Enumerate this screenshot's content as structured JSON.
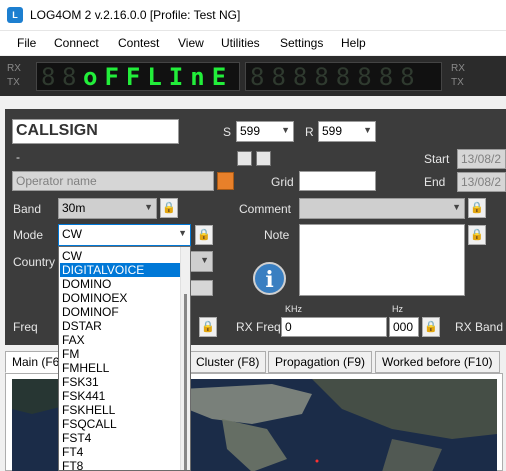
{
  "window": {
    "title": "LOG4OM 2 v.2.16.0.0 [Profile: Test NG]",
    "icon": "app-icon"
  },
  "menu": [
    "File",
    "Connect",
    "Contest",
    "View",
    "Utilities",
    "Settings",
    "Help"
  ],
  "led": {
    "rx": "RX",
    "tx": "TX",
    "display_text": "oFFLInE",
    "right_rx": "RX",
    "right_tx": "TX"
  },
  "qso": {
    "callsign": "CALLSIGN",
    "dash": "-",
    "operator_placeholder": "Operator name",
    "s_label": "S",
    "s_value": "599",
    "r_label": "R",
    "r_value": "599",
    "start_label": "Start",
    "start_value": "13/08/2",
    "end_label": "End",
    "end_value": "13/08/2",
    "grid_label": "Grid",
    "band_label": "Band",
    "band_value": "30m",
    "mode_label": "Mode",
    "mode_value": "CW",
    "comment_label": "Comment",
    "note_label": "Note",
    "country_label": "Country",
    "freq_label": "Freq",
    "rxfreq_label": "RX Freq",
    "khz_label": "KHz",
    "hz_label": "Hz",
    "rxfreq_khz": "0",
    "rxfreq_hz": "000",
    "rxband_label": "RX Band"
  },
  "mode_options": [
    "CW",
    "DIGITALVOICE",
    "DOMINO",
    "DOMINOEX",
    "DOMINOF",
    "DSTAR",
    "FAX",
    "FM",
    "FMHELL",
    "FSK31",
    "FSK441",
    "FSKHELL",
    "FSQCALL",
    "FST4",
    "FT4",
    "FT8"
  ],
  "mode_selected_index": 1,
  "tabs": [
    "Main (F6)",
    "Cluster (F8)",
    "Propagation (F9)",
    "Worked before (F10)"
  ],
  "colors": {
    "led_on": "#22ee3a",
    "panel": "#3c3c3c",
    "selection": "#0078d7",
    "titlebar_icon": "#1d7fd0"
  }
}
